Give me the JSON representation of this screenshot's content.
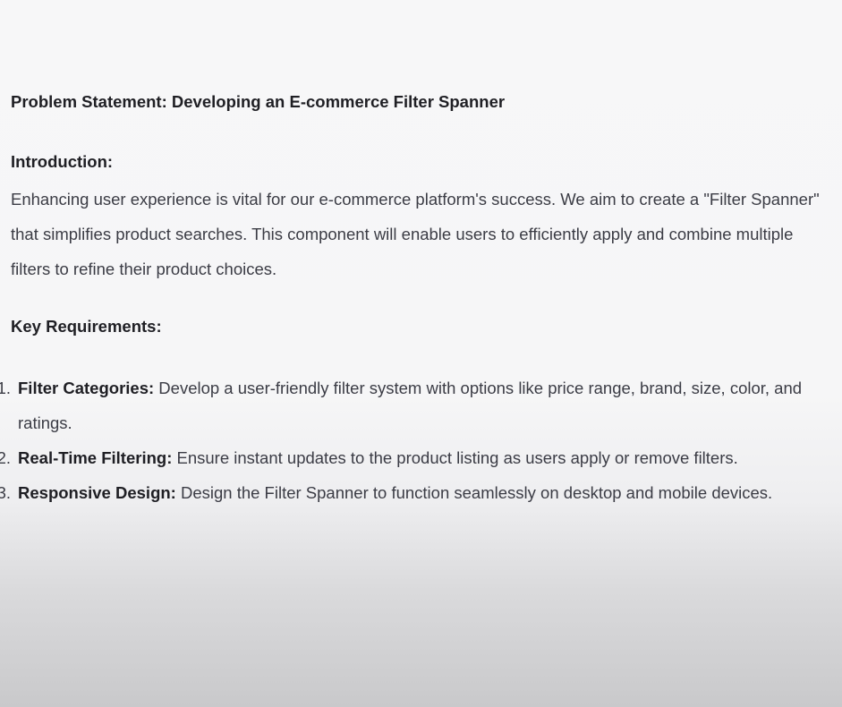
{
  "document": {
    "title": "Problem Statement: Developing an E-commerce Filter Spanner",
    "introduction": {
      "heading": "Introduction:",
      "body": "Enhancing user experience is vital for our e-commerce platform's success. We aim to create a \"Filter Spanner\" that simplifies product searches. This component will enable users to efficiently apply and combine multiple filters to refine their product choices."
    },
    "requirements": {
      "heading": "Key Requirements:",
      "items": [
        {
          "number": "1.",
          "term": "Filter Categories:",
          "text": " Develop a user-friendly filter system with options like price range, brand, size, color, and ratings."
        },
        {
          "number": "2.",
          "term": "Real-Time Filtering:",
          "text": " Ensure instant updates to the product listing as users apply or remove filters."
        },
        {
          "number": "3.",
          "term": "Responsive Design:",
          "text": " Design the Filter Spanner to function seamlessly on desktop and mobile devices."
        }
      ]
    }
  }
}
